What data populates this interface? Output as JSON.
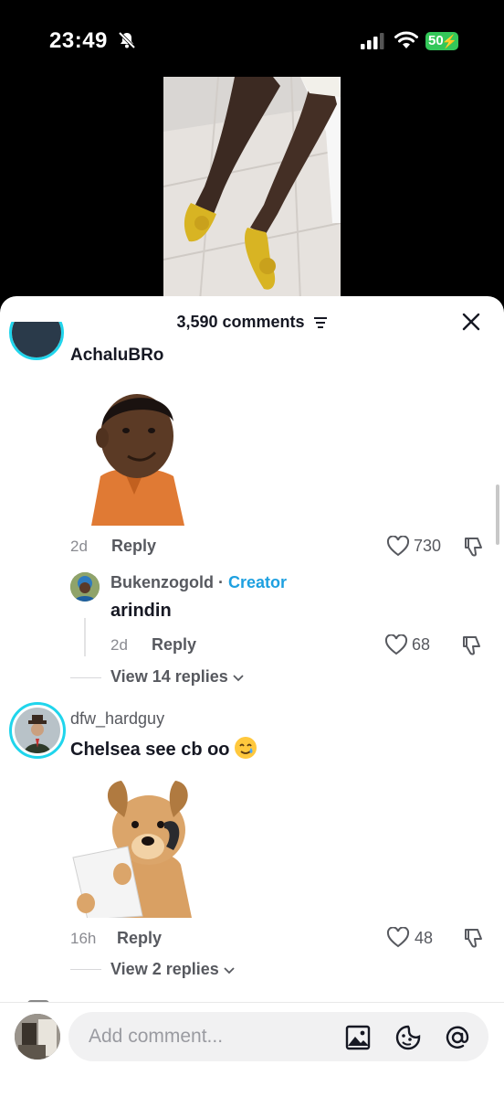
{
  "status_bar": {
    "time": "23:49",
    "battery": "50"
  },
  "sheet": {
    "comment_count": "3,590 comments"
  },
  "comments": [
    {
      "username": "AchaluBRo",
      "age": "2d",
      "reply_label": "Reply",
      "likes": "730",
      "replies": [
        {
          "username": "Bukenzogold",
          "separator": " · ",
          "badge": "Creator",
          "text": "arindin",
          "age": "2d",
          "reply_label": "Reply",
          "likes": "68"
        }
      ],
      "view_replies": "View 14 replies"
    },
    {
      "username": "dfw_hardguy",
      "text": "Chelsea see cb oo",
      "age": "16h",
      "reply_label": "Reply",
      "likes": "48",
      "view_replies": "View 2 replies"
    }
  ],
  "composer": {
    "placeholder": "Add comment..."
  },
  "icons": [
    "bell-slash-icon",
    "signal-icon",
    "wifi-icon",
    "battery-icon",
    "filter-icon",
    "close-icon",
    "heart-icon",
    "dislike-icon",
    "chevron-down-icon",
    "image-icon",
    "sticker-icon",
    "at-icon",
    "tear-smile-emoji"
  ],
  "colors": {
    "creator": "#1ea0e0",
    "ring": "#20d5ec",
    "battery": "#34c759"
  }
}
